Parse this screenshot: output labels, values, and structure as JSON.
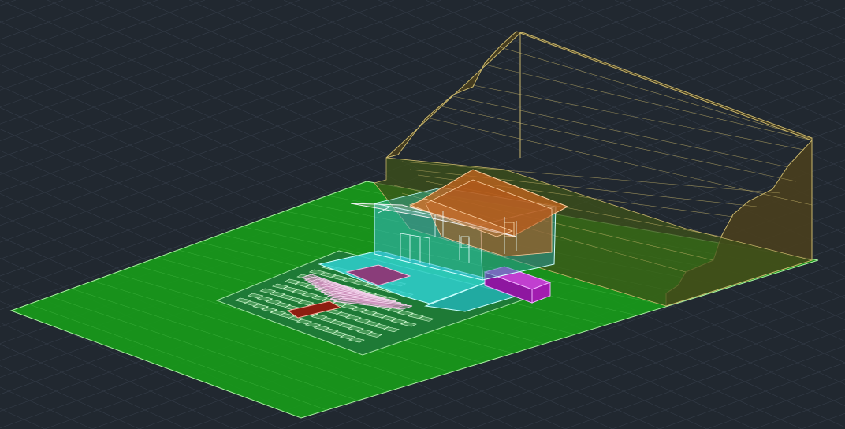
{
  "viewport": {
    "background": "#212830",
    "grid_color": "#3a4350",
    "colors": {
      "ground": "#189a1a",
      "terrain": "#4a3f1c",
      "terrain_edge": "#c9b66b",
      "house_walls": "#34b8c8",
      "roof": "#c8641e",
      "patio": "#2fd0d0",
      "stairs": "#d9a3c9",
      "landing": "#8a3d7a",
      "door_mat": "#8c1d10",
      "planter": "#a21cb0",
      "paving": "#1e7a36"
    }
  }
}
